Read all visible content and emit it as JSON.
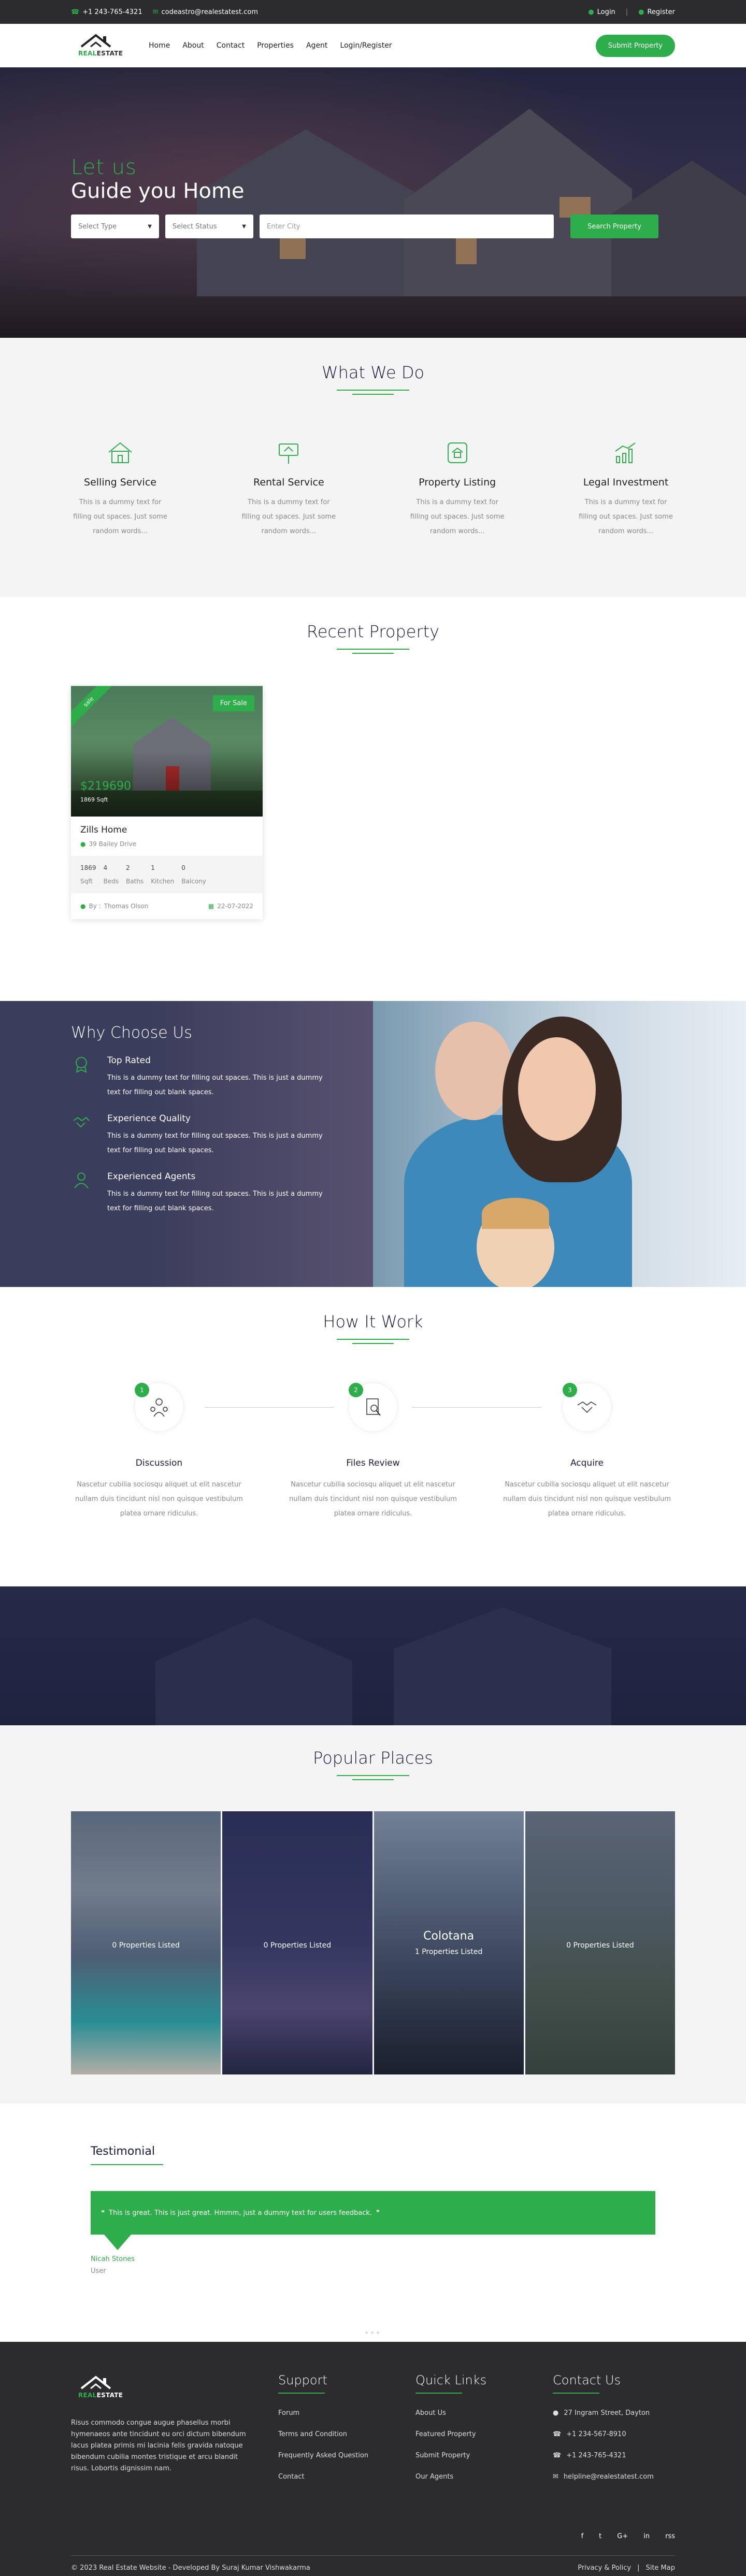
{
  "topbar": {
    "phone": "+1 243-765-4321",
    "email": "codeastro@realestatest.com",
    "login": "Login",
    "register": "Register"
  },
  "header": {
    "logo_text_1": "REAL",
    "logo_text_2": "ESTATE",
    "nav": [
      "Home",
      "About",
      "Contact",
      "Properties",
      "Agent",
      "Login/Register"
    ],
    "submit": "Submit Property"
  },
  "hero": {
    "line1": "Let us",
    "line2": "Guide you Home",
    "select_type": "Select Type",
    "select_status": "Select Status",
    "city_placeholder": "Enter City",
    "search": "Search Property"
  },
  "whatwedo": {
    "title": "What We Do",
    "items": [
      {
        "icon": "house-icon",
        "title": "Selling Service",
        "text": "This is a dummy text for filling out spaces. Just some random words..."
      },
      {
        "icon": "sign-icon",
        "title": "Rental Service",
        "text": "This is a dummy text for filling out spaces. Just some random words..."
      },
      {
        "icon": "listing-icon",
        "title": "Property Listing",
        "text": "This is a dummy text for filling out spaces. Just some random words..."
      },
      {
        "icon": "investment-icon",
        "title": "Legal Investment",
        "text": "This is a dummy text for filling out spaces. Just some random words..."
      }
    ]
  },
  "recent": {
    "title": "Recent Property",
    "card": {
      "ribbon": "sale",
      "badge": "For Sale",
      "price": "$219690",
      "sqft": "1869 Sqft",
      "name": "Zills Home",
      "address": "39 Bailey Drive",
      "specs": [
        {
          "value": "1869",
          "label": "Sqft"
        },
        {
          "value": "4",
          "label": "Beds"
        },
        {
          "value": "2",
          "label": "Baths"
        },
        {
          "value": "1",
          "label": "Kitchen"
        },
        {
          "value": "0",
          "label": "Balcony"
        }
      ],
      "by_label": "By :",
      "agent": "Thomas Olson",
      "date": "22-07-2022"
    }
  },
  "why": {
    "title": "Why Choose Us",
    "features": [
      {
        "icon": "medal-icon",
        "title": "Top Rated",
        "text": "This is a dummy text for filling out spaces. This is just a dummy text for filling out blank spaces."
      },
      {
        "icon": "handshake-icon",
        "title": "Experience Quality",
        "text": "This is a dummy text for filling out spaces. This is just a dummy text for filling out blank spaces."
      },
      {
        "icon": "agent-icon",
        "title": "Experienced Agents",
        "text": "This is a dummy text for filling out spaces. This is just a dummy text for filling out blank spaces."
      }
    ]
  },
  "how": {
    "title": "How It Work",
    "steps": [
      {
        "num": "1",
        "title": "Discussion",
        "text": "Nascetur cubilia sociosqu aliquet ut elit nascetur nullam duis tincidunt nisl non quisque vestibulum platea ornare ridiculus."
      },
      {
        "num": "2",
        "title": "Files Review",
        "text": "Nascetur cubilia sociosqu aliquet ut elit nascetur nullam duis tincidunt nisl non quisque vestibulum platea ornare ridiculus."
      },
      {
        "num": "3",
        "title": "Acquire",
        "text": "Nascetur cubilia sociosqu aliquet ut elit nascetur nullam duis tincidunt nisl non quisque vestibulum platea ornare ridiculus."
      }
    ]
  },
  "popular": {
    "title": "Popular Places",
    "places": [
      {
        "city": "",
        "count": "0 Properties Listed"
      },
      {
        "city": "",
        "count": "0 Properties Listed"
      },
      {
        "city": "Colotana",
        "count": "1 Properties Listed"
      },
      {
        "city": "",
        "count": "0 Properties Listed"
      }
    ]
  },
  "testimonial": {
    "title": "Testimonial",
    "quote": "This is great. This is just great. Hmmm, just a dummy text for users feedback.",
    "name": "Nicah Stones",
    "role": "User"
  },
  "footer": {
    "about": "Risus commodo congue augue phasellus morbi hymenaeos ante tincidunt eu orci dictum bibendum lacus platea primis mi lacinia felis gravida natoque bibendum cubilia montes tristique et arcu blandit risus. Lobortis dignissim nam.",
    "support_title": "Support",
    "support": [
      "Forum",
      "Terms and Condition",
      "Frequently Asked Question",
      "Contact"
    ],
    "quick_title": "Quick Links",
    "quick": [
      "About Us",
      "Featured Property",
      "Submit Property",
      "Our Agents"
    ],
    "contact_title": "Contact Us",
    "contact": [
      "27 Ingram Street, Dayton",
      "+1 234-567-8910",
      "+1 243-765-4321",
      "helpline@realestatest.com"
    ],
    "social": [
      "f",
      "t",
      "G+",
      "in",
      "rss"
    ],
    "copyright": "© 2023 Real Estate Website - Developed By Suraj Kumar Vishwakarma",
    "privacy": "Privacy & Policy",
    "sitemap": "Site Map"
  },
  "colors": {
    "accent": "#2ead4b",
    "dark": "#2c2c2e",
    "navy": "#1a1a3e"
  }
}
